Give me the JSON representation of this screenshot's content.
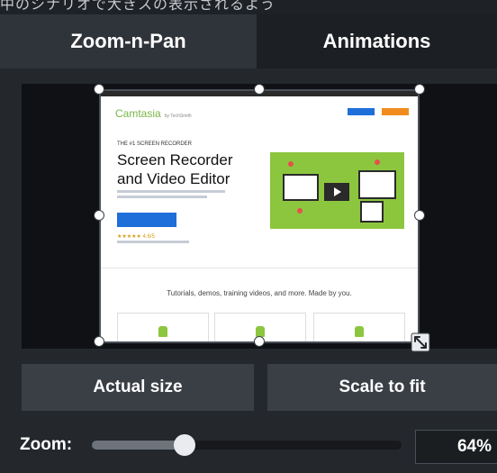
{
  "top_strip_text": "中のシナリオで大きスの表示されるよう",
  "tabs": [
    {
      "label": "Zoom-n-Pan",
      "active": true
    },
    {
      "label": "Animations",
      "active": false
    }
  ],
  "preview": {
    "logo": "Camtasia",
    "logo_tag": "by TechSmith",
    "kicker": "THE #1 SCREEN RECORDER",
    "headline": "Screen Recorder and Video Editor",
    "rating": "★★★★★ 4.6/5",
    "caption": "Tutorials, demos, training videos, and more. Made by you."
  },
  "buttons": {
    "actual_size": "Actual size",
    "scale_to_fit": "Scale to fit"
  },
  "zoom": {
    "label": "Zoom:",
    "value_text": "64%",
    "slider_fraction": 0.3
  },
  "colors": {
    "background": "#24282d",
    "tab_active": "#2f343a",
    "tab_inactive": "#1c1f23",
    "button": "#3a3f46",
    "canvas": "#0f1114",
    "accent_green": "#8cc63f",
    "accent_blue": "#1e6fd9",
    "accent_orange": "#f08c1e"
  }
}
